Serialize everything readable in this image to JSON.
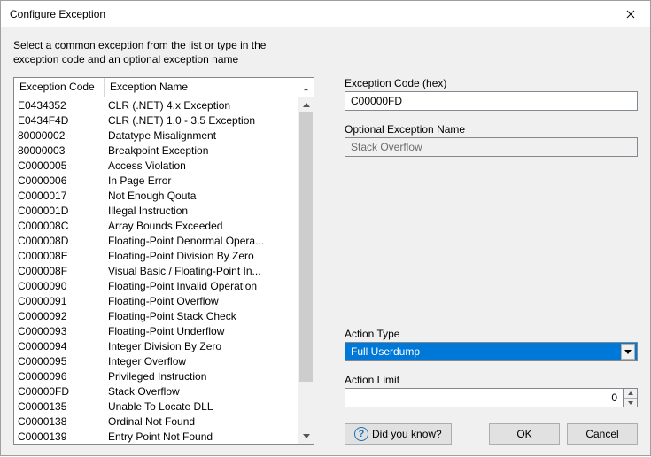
{
  "window": {
    "title": "Configure Exception",
    "instructions": "Select a common exception from the list or type in the exception code and an optional exception name"
  },
  "list": {
    "headers": {
      "code": "Exception Code",
      "name": "Exception Name"
    },
    "rows": [
      {
        "code": "E0434352",
        "name": "CLR (.NET) 4.x Exception"
      },
      {
        "code": "E0434F4D",
        "name": "CLR (.NET) 1.0 - 3.5 Exception"
      },
      {
        "code": "80000002",
        "name": "Datatype Misalignment"
      },
      {
        "code": "80000003",
        "name": "Breakpoint Exception"
      },
      {
        "code": "C0000005",
        "name": "Access Violation"
      },
      {
        "code": "C0000006",
        "name": "In Page Error"
      },
      {
        "code": "C0000017",
        "name": "Not Enough Qouta"
      },
      {
        "code": "C000001D",
        "name": "Illegal Instruction"
      },
      {
        "code": "C000008C",
        "name": "Array Bounds Exceeded"
      },
      {
        "code": "C000008D",
        "name": "Floating-Point Denormal Opera..."
      },
      {
        "code": "C000008E",
        "name": "Floating-Point Division By Zero"
      },
      {
        "code": "C000008F",
        "name": "Visual Basic / Floating-Point In..."
      },
      {
        "code": "C0000090",
        "name": "Floating-Point Invalid Operation"
      },
      {
        "code": "C0000091",
        "name": "Floating-Point Overflow"
      },
      {
        "code": "C0000092",
        "name": "Floating-Point Stack Check"
      },
      {
        "code": "C0000093",
        "name": "Floating-Point Underflow"
      },
      {
        "code": "C0000094",
        "name": "Integer Division By Zero"
      },
      {
        "code": "C0000095",
        "name": "Integer Overflow"
      },
      {
        "code": "C0000096",
        "name": "Privileged Instruction"
      },
      {
        "code": "C00000FD",
        "name": "Stack Overflow"
      },
      {
        "code": "C0000135",
        "name": "Unable To Locate DLL"
      },
      {
        "code": "C0000138",
        "name": "Ordinal Not Found"
      },
      {
        "code": "C0000139",
        "name": "Entry Point Not Found"
      }
    ]
  },
  "form": {
    "code_label": "Exception Code (hex)",
    "code_value": "C00000FD",
    "name_label": "Optional Exception Name",
    "name_value": "Stack Overflow",
    "action_type_label": "Action Type",
    "action_type_value": "Full Userdump",
    "action_limit_label": "Action Limit",
    "action_limit_value": "0"
  },
  "buttons": {
    "hint": "Did you know?",
    "ok": "OK",
    "cancel": "Cancel"
  }
}
